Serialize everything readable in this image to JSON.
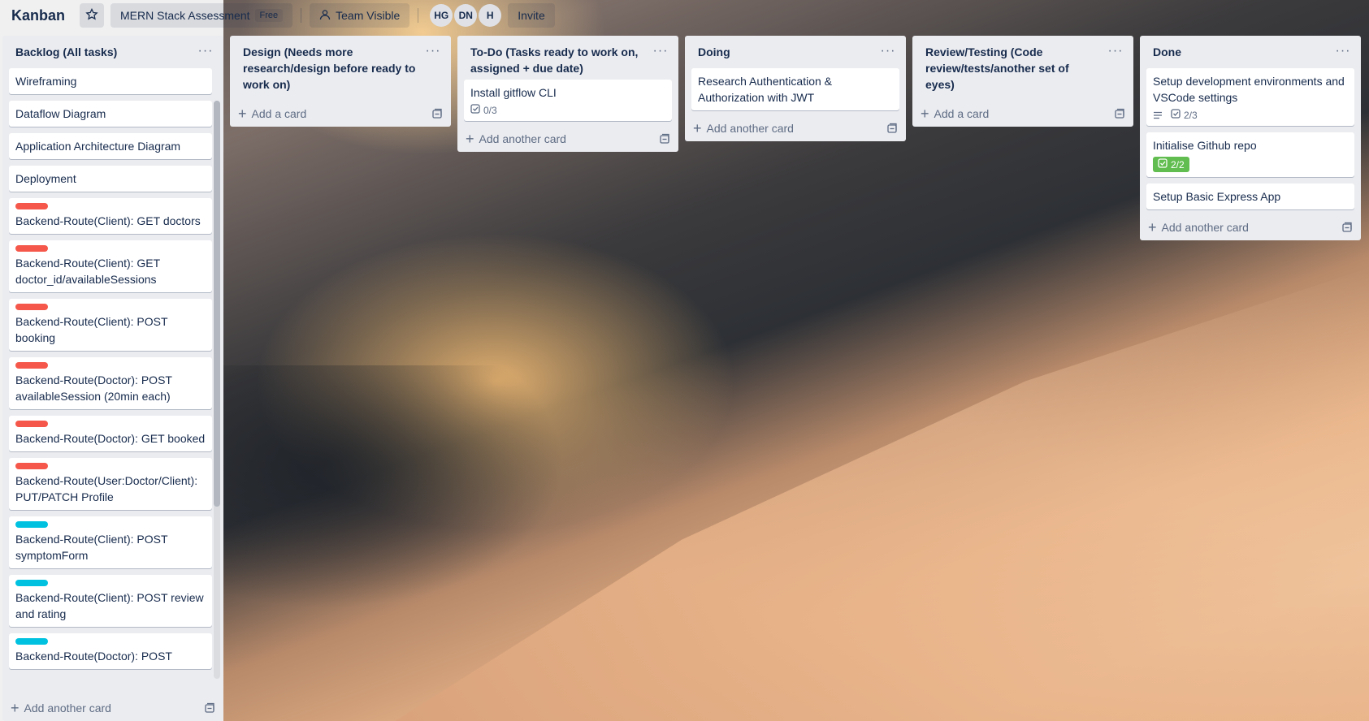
{
  "header": {
    "board_title": "Kanban",
    "workspace_label": "MERN Stack Assessment",
    "plan_badge": "Free",
    "visibility_label": "Team Visible",
    "members": [
      "HG",
      "DN",
      "H"
    ],
    "invite_label": "Invite"
  },
  "colors": {
    "label_red": "#f5584a",
    "label_cyan": "#00c2e0",
    "badge_green": "#61bd4f",
    "list_bg": "#ebecf0"
  },
  "lists": [
    {
      "title": "Backlog (All tasks)",
      "footer": "Add another card",
      "cards": [
        {
          "text": "Wireframing"
        },
        {
          "text": "Dataflow Diagram"
        },
        {
          "text": "Application Architecture Diagram"
        },
        {
          "text": "Deployment"
        },
        {
          "text": "Backend-Route(Client): GET doctors",
          "label": "red"
        },
        {
          "text": "Backend-Route(Client): GET doctor_id/availableSessions",
          "label": "red"
        },
        {
          "text": "Backend-Route(Client): POST booking",
          "label": "red"
        },
        {
          "text": "Backend-Route(Doctor): POST availableSession (20min each)",
          "label": "red"
        },
        {
          "text": "Backend-Route(Doctor): GET booked",
          "label": "red"
        },
        {
          "text": "Backend-Route(User:Doctor/Client): PUT/PATCH Profile",
          "label": "red"
        },
        {
          "text": "Backend-Route(Client): POST symptomForm",
          "label": "cyan"
        },
        {
          "text": "Backend-Route(Client): POST review and rating",
          "label": "cyan"
        },
        {
          "text": "Backend-Route(Doctor): POST",
          "label": "cyan"
        }
      ]
    },
    {
      "title": "Design (Needs more research/design before ready to work on)",
      "footer": "Add a card",
      "cards": []
    },
    {
      "title": "To-Do (Tasks ready to work on, assigned + due date)",
      "footer": "Add another card",
      "cards": [
        {
          "text": "Install gitflow CLI",
          "checklist": "0/3"
        }
      ]
    },
    {
      "title": "Doing",
      "footer": "Add another card",
      "cards": [
        {
          "text": "Research Authentication & Authorization with JWT"
        }
      ]
    },
    {
      "title": "Review/Testing (Code review/tests/another set of eyes)",
      "footer": "Add a card",
      "cards": []
    },
    {
      "title": "Done",
      "footer": "Add another card",
      "cards": [
        {
          "text": "Setup development environments and VSCode settings",
          "description": true,
          "checklist": "2/3"
        },
        {
          "text": "Initialise Github repo",
          "checklist": "2/2",
          "complete": true
        },
        {
          "text": "Setup Basic Express App"
        }
      ]
    }
  ]
}
